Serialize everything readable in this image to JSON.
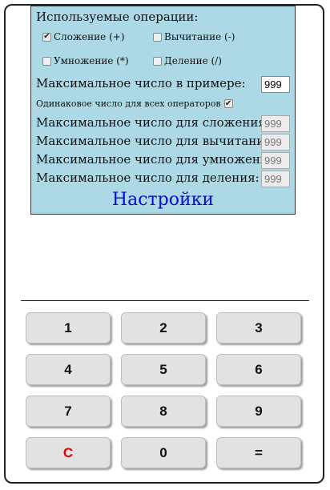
{
  "settings": {
    "ops_title": "Используемые операции:",
    "ops": {
      "add": {
        "label": "Сложение (+)",
        "checked": true
      },
      "sub": {
        "label": "Вычитание (-)",
        "checked": false
      },
      "mul": {
        "label": "Умножение (*)",
        "checked": false
      },
      "div": {
        "label": "Деление (/)",
        "checked": false
      }
    },
    "max_label": "Максимальное число в примере:",
    "max_value": "999",
    "same_label": "Одинаковое число для всех операторов",
    "same_checked": true,
    "max_add_label": "Максимальное число для сложения:",
    "max_add_value": "999",
    "max_sub_label": "Максимальное число для вычитания:",
    "max_sub_value": "999",
    "max_mul_label": "Максимальное число для умножения:",
    "max_mul_value": "999",
    "max_div_label": "Максимальное число для деления:",
    "max_div_value": "999",
    "title": "Настройки",
    "title_color": "#0a0ad6",
    "panel_color": "#add8e6"
  },
  "keypad": {
    "keys": [
      "1",
      "2",
      "3",
      "4",
      "5",
      "6",
      "7",
      "8",
      "9",
      "C",
      "0",
      "="
    ],
    "clear_color": "#e00000"
  },
  "icons": {
    "check_glyph": "✔"
  }
}
